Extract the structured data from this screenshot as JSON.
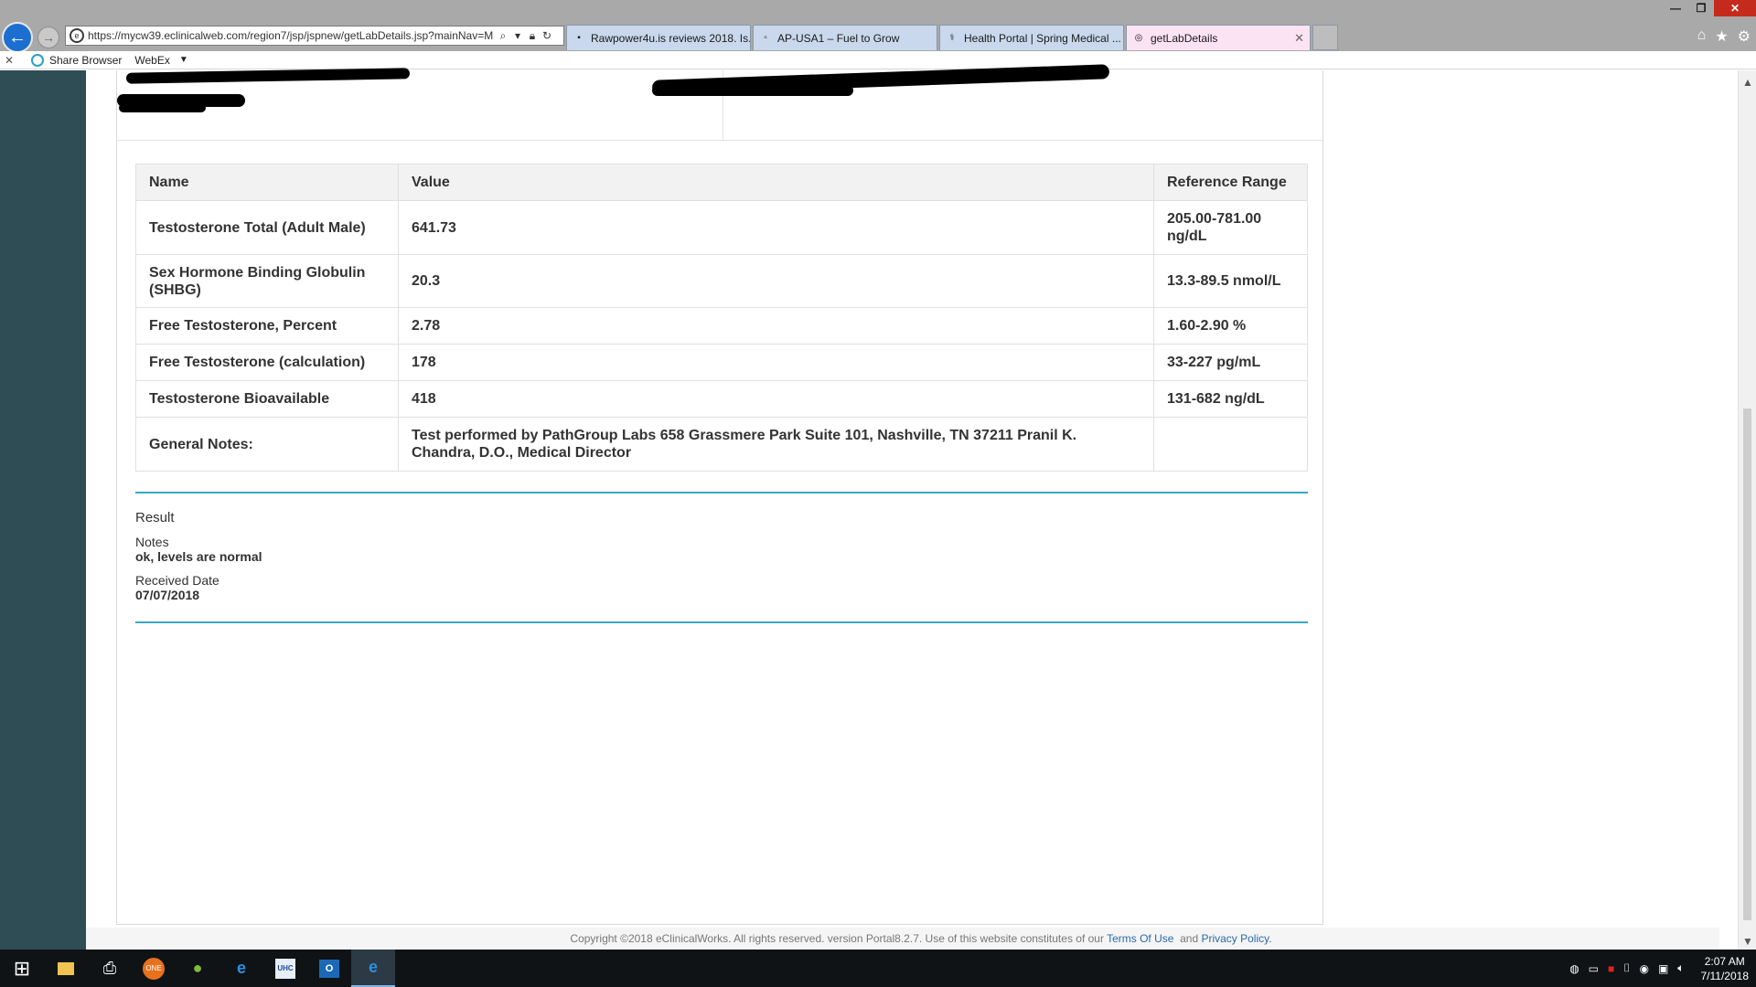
{
  "browser": {
    "url": "https://mycw39.eclinicalweb.com/region7/jsp/jspnew/getLabDetails.jsp?mainNav=M",
    "tabs": [
      {
        "label": "Rawpower4u.is reviews 2018. Is...",
        "icon": "page-icon"
      },
      {
        "label": "AP-USA1 – Fuel to Grow",
        "icon": "apusa-icon"
      },
      {
        "label": "Health Portal | Spring Medical ...",
        "icon": "caduceus-icon"
      },
      {
        "label": "getLabDetails",
        "icon": "eclinical-icon",
        "active": true
      }
    ],
    "favorites": [
      {
        "label": "Share Browser",
        "icon": "share-icon"
      },
      {
        "label": "WebEx",
        "icon": "webex-icon"
      }
    ]
  },
  "lab": {
    "headers": {
      "name": "Name",
      "value": "Value",
      "range": "Reference Range"
    },
    "rows": [
      {
        "name": "Testosterone Total (Adult Male)",
        "value": "641.73",
        "range": "205.00-781.00 ng/dL"
      },
      {
        "name": "Sex Hormone Binding Globulin (SHBG)",
        "value": "20.3",
        "range": "13.3-89.5 nmol/L"
      },
      {
        "name": "Free Testosterone, Percent",
        "value": "2.78",
        "range": "1.60-2.90 %"
      },
      {
        "name": "Free Testosterone (calculation)",
        "value": "178",
        "range": "33-227 pg/mL"
      },
      {
        "name": "Testosterone Bioavailable",
        "value": "418",
        "range": "131-682 ng/dL"
      },
      {
        "name": "General Notes:",
        "value": "Test performed by PathGroup Labs 658 Grassmere Park Suite 101, Nashville, TN 37211 Pranil K. Chandra, D.O., Medical Director",
        "range": ""
      }
    ]
  },
  "result": {
    "title": "Result",
    "notes_label": "Notes",
    "notes_value": "ok, levels are normal",
    "received_label": "Received Date",
    "received_value": "07/07/2018"
  },
  "footer": {
    "text": "Copyright ©2018 eClinicalWorks. All rights reserved. version  Portal8.2.7.  Use of this website constitutes of our ",
    "terms": "Terms Of Use",
    "and": "  and ",
    "privacy": "Privacy Policy."
  },
  "taskbar": {
    "apps": [
      "file-explorer-icon",
      "printer-icon",
      "onenote-icon",
      "green-app-icon",
      "ie-icon",
      "uhc-icon",
      "outlook-icon",
      "ie-active-icon"
    ],
    "time": "2:07 AM",
    "date": "7/11/2018"
  },
  "colors": {
    "accent_rule": "#3aa6c7",
    "left_rail": "#2f4d55",
    "link": "#2a6aa8",
    "active_tab": "#fbe3f4"
  }
}
